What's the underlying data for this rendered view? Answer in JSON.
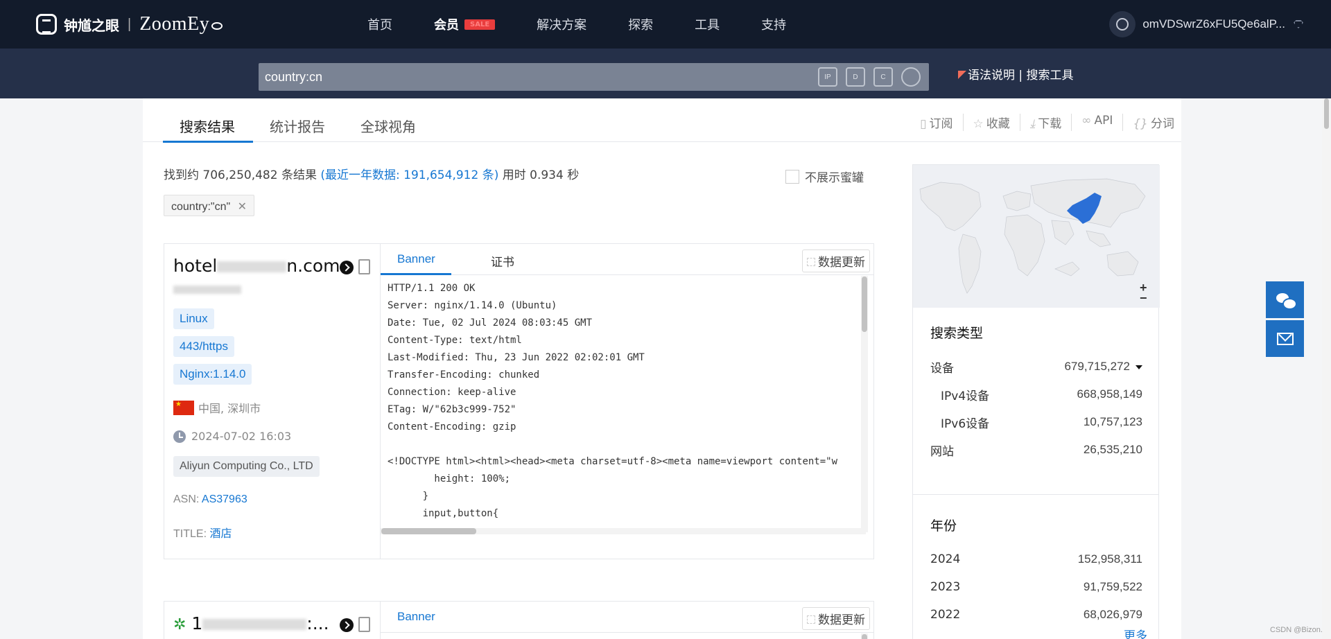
{
  "nav": {
    "logo_cn": "钟馗之眼",
    "logo_sep": "|",
    "logo_en": "ZoomEy",
    "links": [
      "首页",
      "会员",
      "解决方案",
      "探索",
      "工具",
      "支持"
    ],
    "vip_badge": "SALE",
    "username": "omVDSwrZ6xFU5Qe6alP..."
  },
  "search": {
    "query": "country:cn",
    "icons": [
      "IP",
      "D",
      "C"
    ],
    "syntax_link": "语法说明",
    "sep": "|",
    "tools_link": "搜索工具"
  },
  "tabs": [
    "搜索结果",
    "统计报告",
    "全球视角"
  ],
  "tools": [
    "订阅",
    "收藏",
    "下载",
    "API",
    "分词"
  ],
  "summary": {
    "prefix": "找到约 706,250,482 条结果",
    "recent": "(最近一年数据: 191,654,912 条)",
    "time": "用时 0.934 秒"
  },
  "honeypot_label": "不展示蜜罐",
  "filter_chip": "country:\"cn\"",
  "result1": {
    "host_prefix": "hotel",
    "host_suffix": "n.com",
    "tags": [
      "Linux",
      "443/https",
      "Nginx:1.14.0"
    ],
    "location": "中国, 深圳市",
    "time": "2024-07-02 16:03",
    "org": "Aliyun Computing Co., LTD",
    "asn_label": "ASN:",
    "asn": "AS37963",
    "title_label": "TITLE:",
    "title": "酒店",
    "tab_banner": "Banner",
    "tab_cert": "证书",
    "update_btn": "数据更新",
    "banner": "HTTP/1.1 200 OK\nServer: nginx/1.14.0 (Ubuntu)\nDate: Tue, 02 Jul 2024 08:03:45 GMT\nContent-Type: text/html\nLast-Modified: Thu, 23 Jun 2022 02:02:01 GMT\nTransfer-Encoding: chunked\nConnection: keep-alive\nETag: W/\"62b3c999-752\"\nContent-Encoding: gzip\n\n<!DOCTYPE html><html><head><meta charset=utf-8><meta name=viewport content=\"w\n        height: 100%;\n      }\n      input,button{"
  },
  "result2": {
    "host_prefix": "1",
    "host_suffix": ":...",
    "tab_banner": "Banner",
    "update_btn": "数据更新"
  },
  "map": {
    "zoom_in": "+",
    "zoom_out": "−",
    "highlight_color": "#2b6fd6"
  },
  "search_type": {
    "title": "搜索类型",
    "rows": [
      {
        "label": "设备",
        "value": "679,715,272"
      },
      {
        "label": "IPv4设备",
        "value": "668,958,149"
      },
      {
        "label": "IPv6设备",
        "value": "10,757,123"
      },
      {
        "label": "网站",
        "value": "26,535,210"
      }
    ]
  },
  "year": {
    "title": "年份",
    "rows": [
      {
        "label": "2024",
        "value": "152,958,311"
      },
      {
        "label": "2023",
        "value": "91,759,522"
      },
      {
        "label": "2022",
        "value": "68,026,979"
      }
    ],
    "more": "更多"
  },
  "watermark": "CSDN @Bizon."
}
